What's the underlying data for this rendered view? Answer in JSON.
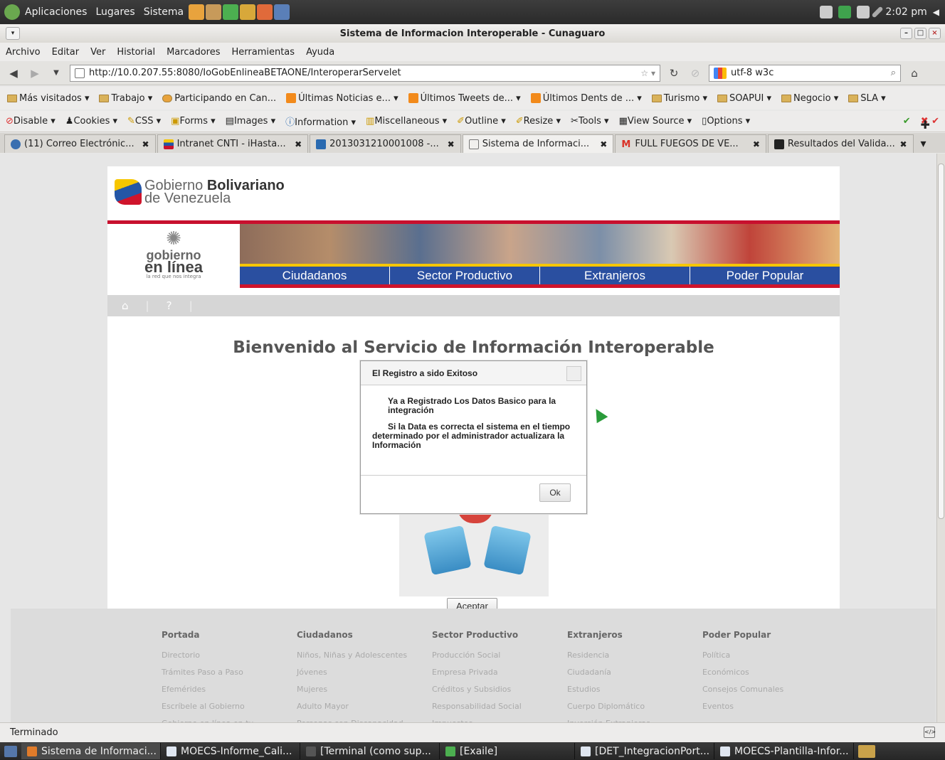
{
  "panel": {
    "menus": [
      "Aplicaciones",
      "Lugares",
      "Sistema"
    ],
    "clock": "2:02 pm"
  },
  "window": {
    "title": "Sistema de Informacion Interoperable - Cunaguaro"
  },
  "menubar": [
    "Archivo",
    "Editar",
    "Ver",
    "Historial",
    "Marcadores",
    "Herramientas",
    "Ayuda"
  ],
  "navbar": {
    "url": "http://10.0.207.55:8080/IoGobEnlineaBETAONE/InteroperarServelet",
    "search_value": "utf-8 w3c"
  },
  "bookmarks": [
    "Más visitados ▾",
    "Trabajo ▾",
    "Participando en Can...",
    "Últimas Noticias e... ▾",
    "Últimos Tweets de... ▾",
    "Últimos Dents de ... ▾",
    "Turismo ▾",
    "SOAPUI ▾",
    "Negocio ▾",
    "SLA ▾"
  ],
  "devtools": [
    "Disable ▾",
    "Cookies ▾",
    "CSS ▾",
    "Forms ▾",
    "Images ▾",
    "Information ▾",
    "Miscellaneous ▾",
    "Outline ▾",
    "Resize ▾",
    "Tools ▾",
    "View Source ▾",
    "Options ▾"
  ],
  "tabs": [
    {
      "label": "(11) Correo Electrónic...",
      "color": "#3a6fb0"
    },
    {
      "label": "Intranet CNTI - iHasta...",
      "color": "#c8102e"
    },
    {
      "label": "2013031210001008 -...",
      "color": "#2a6ab0"
    },
    {
      "label": "Sistema de Informaci...",
      "color": "#999999"
    },
    {
      "label": "FULL FUEGOS DE VE...",
      "color": "#d93025"
    },
    {
      "label": "Resultados del Valida...",
      "color": "#222222"
    }
  ],
  "site": {
    "logo_line1_light": "Gobierno ",
    "logo_line1_bold": "Bolivariano",
    "logo_line2": "de Venezuela",
    "gol_line1": "gobierno",
    "gol_line2": "en línea",
    "gol_tagline": "la red que nos integra",
    "nav": [
      "Ciudadanos",
      "Sector Productivo",
      "Extranjeros",
      "Poder Popular"
    ],
    "welcome": "Bienvenido al Servicio de Información Interoperable",
    "aceptar": "Aceptar"
  },
  "dialog": {
    "title": "El Registro a sido Exitoso",
    "p1": "Ya a Registrado Los Datos Basico para la integración",
    "p2": "Si la Data es correcta el sistema en el tiempo determinado por el administrador actualizara la Información",
    "ok": "Ok"
  },
  "footer": {
    "columns": [
      {
        "title": "Portada",
        "links": [
          "Directorio",
          "Trámites Paso a Paso",
          "Efemérides",
          "Escríbele al Gobierno",
          "Gobierno en línea en tu"
        ]
      },
      {
        "title": "Ciudadanos",
        "links": [
          "Niños, Niñas y Adolescentes",
          "Jóvenes",
          "Mujeres",
          "Adulto Mayor",
          "Personas con Discapacidad"
        ]
      },
      {
        "title": "Sector Productivo",
        "links": [
          "Producción Social",
          "Empresa Privada",
          "Créditos y Subsidios",
          "Responsabilidad Social",
          "Impuestos"
        ]
      },
      {
        "title": "Extranjeros",
        "links": [
          "Residencia",
          "Ciudadanía",
          "Estudios",
          "Cuerpo Diplomático",
          "Inversión Extranjeras"
        ]
      },
      {
        "title": "Poder Popular",
        "links": [
          "Política",
          "Económicos",
          "Consejos Comunales",
          "Eventos"
        ]
      }
    ]
  },
  "status": "Terminado",
  "taskbar": [
    "Sistema de Informaci...",
    "MOECS-Informe_Cali...",
    "[Terminal (como sup...",
    "[Exaile]",
    "[DET_IntegracionPort...",
    "MOECS-Plantilla-Infor..."
  ]
}
